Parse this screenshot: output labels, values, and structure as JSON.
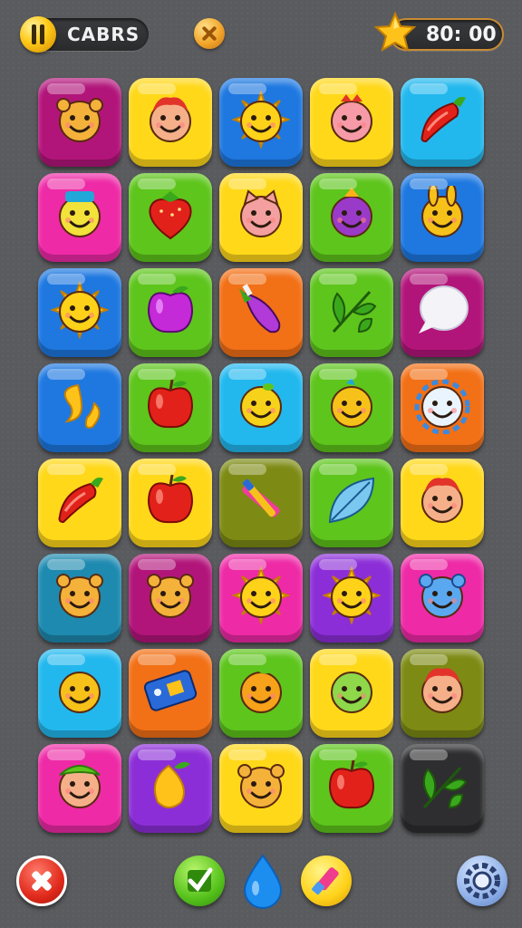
{
  "hud": {
    "player_label": "CABRS",
    "timer": "80: 00"
  },
  "colors": {
    "magenta": "#b2157a",
    "yellow": "#ffd81a",
    "blue": "#1e78e0",
    "cyan": "#22b8ee",
    "pink": "#ee2aa6",
    "green": "#5ec51c",
    "orange": "#f27016",
    "purple": "#8c2ed8",
    "olive": "#7d8a14",
    "teal": "#1e8ab0",
    "dark": "#2e2e30",
    "lightgreen": "#6fd02c"
  },
  "board": {
    "rows": [
      [
        {
          "color": "magenta",
          "icon": "bear-face-icon"
        },
        {
          "color": "yellow",
          "icon": "redhead-face-icon"
        },
        {
          "color": "blue",
          "icon": "sun-icon"
        },
        {
          "color": "yellow",
          "icon": "pink-face-icon"
        },
        {
          "color": "cyan",
          "icon": "chili-pepper-icon"
        }
      ],
      [
        {
          "color": "pink",
          "icon": "hat-face-icon"
        },
        {
          "color": "green",
          "icon": "strawberry-icon"
        },
        {
          "color": "yellow",
          "icon": "cat-face-icon"
        },
        {
          "color": "green",
          "icon": "purple-monster-icon"
        },
        {
          "color": "blue",
          "icon": "bunny-face-icon"
        }
      ],
      [
        {
          "color": "blue",
          "icon": "sun-icon"
        },
        {
          "color": "green",
          "icon": "plum-icon"
        },
        {
          "color": "orange",
          "icon": "eggplant-icon"
        },
        {
          "color": "green",
          "icon": "leaf-branch-icon"
        },
        {
          "color": "magenta",
          "icon": "speech-bubble-icon"
        }
      ],
      [
        {
          "color": "blue",
          "icon": "swirl-icon"
        },
        {
          "color": "green",
          "icon": "apple-icon"
        },
        {
          "color": "cyan",
          "icon": "lemon-face-icon"
        },
        {
          "color": "green",
          "icon": "chick-face-icon"
        },
        {
          "color": "orange",
          "icon": "snowflake-face-icon"
        }
      ],
      [
        {
          "color": "yellow",
          "icon": "chili-pepper-icon"
        },
        {
          "color": "yellow",
          "icon": "apple-icon"
        },
        {
          "color": "olive",
          "icon": "crossed-brushes-icon"
        },
        {
          "color": "green",
          "icon": "leaf-icon"
        },
        {
          "color": "yellow",
          "icon": "redhead-face-icon"
        }
      ],
      [
        {
          "color": "teal",
          "icon": "bear-face-icon"
        },
        {
          "color": "magenta",
          "icon": "bear-face-icon"
        },
        {
          "color": "pink",
          "icon": "sun-icon"
        },
        {
          "color": "purple",
          "icon": "sun-icon"
        },
        {
          "color": "pink",
          "icon": "blue-bear-icon"
        }
      ],
      [
        {
          "color": "cyan",
          "icon": "smiley-face-icon"
        },
        {
          "color": "orange",
          "icon": "phone-icon"
        },
        {
          "color": "green",
          "icon": "orange-face-icon"
        },
        {
          "color": "yellow",
          "icon": "green-blob-icon"
        },
        {
          "color": "olive",
          "icon": "redhead-face-icon"
        }
      ],
      [
        {
          "color": "pink",
          "icon": "leaf-hat-face-icon"
        },
        {
          "color": "purple",
          "icon": "mango-icon"
        },
        {
          "color": "yellow",
          "icon": "bear-face-icon"
        },
        {
          "color": "green",
          "icon": "apple-icon"
        },
        {
          "color": "dark",
          "icon": "leaf-branch-icon"
        }
      ]
    ]
  },
  "bottom_bar": {
    "close_icon": "close-icon",
    "check_icon": "check-icon",
    "drop_icon": "water-drop-icon",
    "paint_icon": "paint-tube-icon",
    "settings_icon": "gear-icon"
  }
}
